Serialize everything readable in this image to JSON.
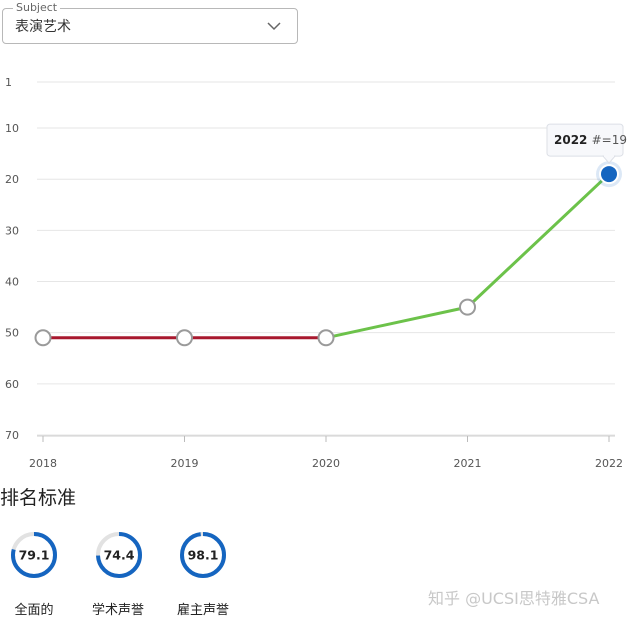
{
  "subject_select": {
    "legend": "Subject",
    "value": "表演艺术",
    "chevron_icon": "chevron-down-icon"
  },
  "chart_data": {
    "type": "line",
    "title": "",
    "xlabel": "",
    "ylabel": "",
    "x": [
      "2018",
      "2019",
      "2020",
      "2021",
      "2022"
    ],
    "y_ticks": [
      "1",
      "10",
      "20",
      "30",
      "40",
      "50",
      "60",
      "70"
    ],
    "ylim": [
      70,
      1
    ],
    "y_inverted": true,
    "series": [
      {
        "values": [
          51,
          51,
          51,
          45,
          19
        ]
      }
    ],
    "segment_colors": [
      "#a8182e",
      "#a8182e",
      "#6cc24a",
      "#6cc24a"
    ],
    "highlight_point": {
      "year": "2022",
      "prefix": "#=",
      "value": "19",
      "color": "#1565c0"
    },
    "grid": true,
    "legend": "none"
  },
  "ranking_criteria": {
    "title": "排名标准",
    "gauges": [
      {
        "value": "79.1",
        "fraction": 0.791,
        "label": "全面的"
      },
      {
        "value": "74.4",
        "fraction": 0.744,
        "label": "学术声誉"
      },
      {
        "value": "98.1",
        "fraction": 0.981,
        "label": "雇主声誉"
      }
    ]
  },
  "watermark": "知乎 @UCSI思特雅CSA",
  "colors": {
    "gauge_fill": "#1565c0",
    "gauge_track": "#e2e2e2",
    "decline_line": "#a8182e",
    "rise_line": "#6cc24a",
    "highlight": "#1565c0"
  }
}
